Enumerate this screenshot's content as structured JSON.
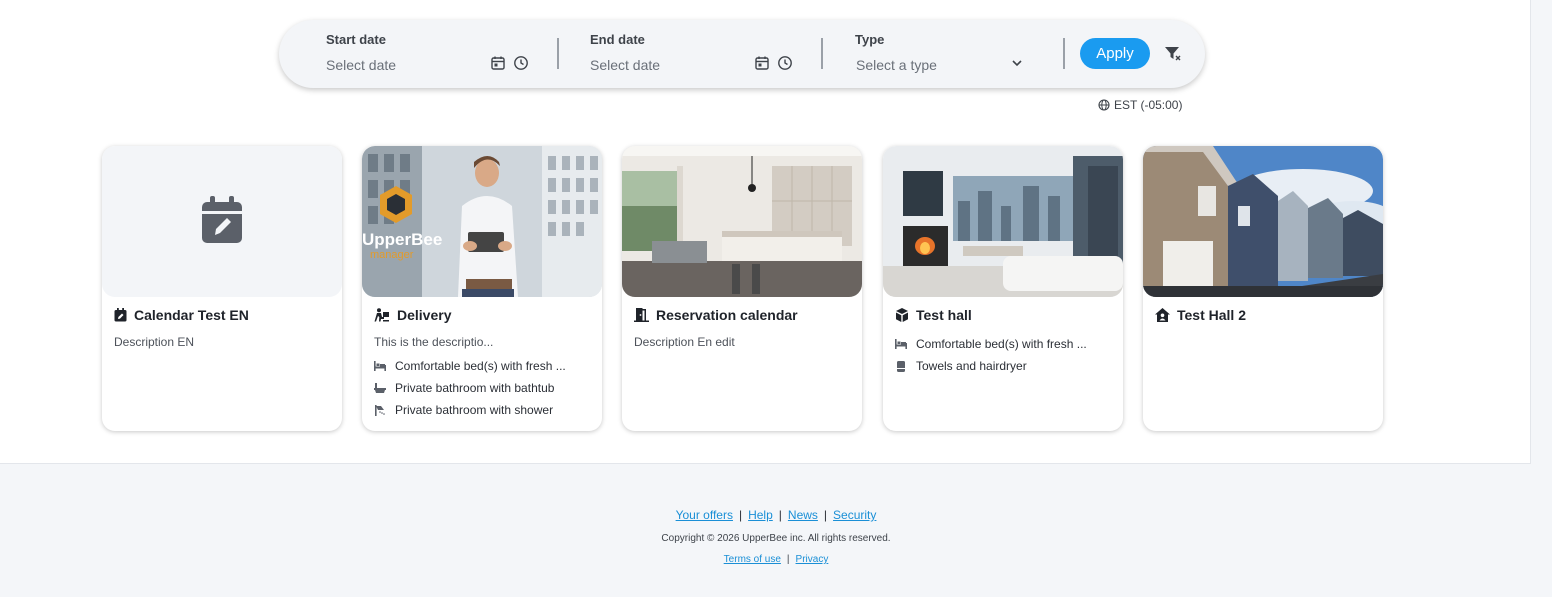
{
  "filters": {
    "start": {
      "label": "Start date",
      "placeholder": "Select date"
    },
    "end": {
      "label": "End date",
      "placeholder": "Select date"
    },
    "type": {
      "label": "Type",
      "placeholder": "Select a type"
    },
    "apply_label": "Apply"
  },
  "timezone": "EST (-05:00)",
  "cards": [
    {
      "title": "Calendar Test EN",
      "description": "Description EN",
      "icon": "calendar-edit-icon",
      "image": "calendar-placeholder",
      "amenities": []
    },
    {
      "title": "Delivery",
      "description": "This is the descriptio...",
      "icon": "delivery-person-icon",
      "image": "upperbee-manager-photo",
      "logo_text": "UpperBee",
      "logo_sub": "manager",
      "amenities": [
        {
          "icon": "bed-icon",
          "label": "Comfortable bed(s) with fresh ..."
        },
        {
          "icon": "bathtub-icon",
          "label": "Private bathroom with bathtub"
        },
        {
          "icon": "shower-icon",
          "label": "Private bathroom with shower"
        }
      ]
    },
    {
      "title": "Reservation calendar",
      "description": "Description En edit",
      "icon": "door-open-icon",
      "image": "apartment-kitchen-photo",
      "amenities": []
    },
    {
      "title": "Test hall",
      "description": "",
      "icon": "cube-icon",
      "image": "living-room-photo",
      "amenities": [
        {
          "icon": "bed-icon",
          "label": "Comfortable bed(s) with fresh ..."
        },
        {
          "icon": "towel-icon",
          "label": "Towels and hairdryer"
        }
      ]
    },
    {
      "title": "Test Hall 2",
      "description": "",
      "icon": "house-user-icon",
      "image": "townhouses-photo",
      "amenities": []
    }
  ],
  "footer": {
    "links": [
      "Your offers",
      "Help",
      "News",
      "Security"
    ],
    "copyright": "Copyright © 2026 UpperBee inc. All rights reserved.",
    "legal": [
      "Terms of use",
      "Privacy"
    ]
  },
  "colors": {
    "accent": "#1a9bf0",
    "link": "#1a8fd6",
    "footer_bg": "#f4f6f9"
  }
}
